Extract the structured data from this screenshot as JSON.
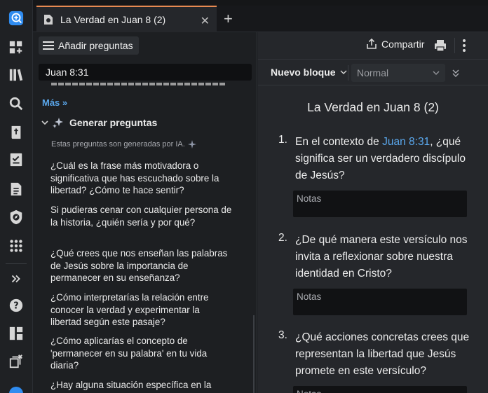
{
  "rail": {
    "icons": [
      "app-logo-icon",
      "dashboard-add-icon",
      "library-icon",
      "search-icon",
      "bible-icon",
      "checklist-icon",
      "document-icon",
      "compass-icon",
      "apps-grid-icon",
      "expand-chevrons-icon",
      "help-icon",
      "layout-icon",
      "close-panels-icon"
    ]
  },
  "tab": {
    "title": "La Verdad en Juan 8 (2)",
    "close": "✕",
    "new": "+"
  },
  "left": {
    "add_questions": "Añadir preguntas",
    "search_value": "Juan 8:31",
    "more": "Más »",
    "generate_label": "Generar preguntas",
    "ai_note": "Estas preguntas son generadas por IA.",
    "questions": [
      "¿Cuál es la frase más motivadora o significativa que has escuchado sobre la libertad? ¿Cómo te hace sentir?",
      "Si pudieras cenar con cualquier persona de la historia, ¿quién sería y por qué?",
      "¿Qué crees que nos enseñan las palabras de Jesús sobre la importancia de permanecer en su enseñanza?",
      "¿Cómo interpretarías la relación entre conocer la verdad y experimentar la libertad según este pasaje?",
      "¿Cómo aplicarías el concepto de 'permanecer en su palabra' en tu vida diaria?",
      "¿Hay alguna situación específica en la"
    ]
  },
  "right": {
    "share": "Compartir",
    "block_type": "Nuevo bloque",
    "style_select": "Normal",
    "doc_title": "La Verdad en Juan 8 (2)",
    "items": [
      {
        "num": "1.",
        "pre": "En el contexto de ",
        "ref": "Juan 8:31",
        "post": ", ¿qué significa ser un verdadero discípulo de Jesús?",
        "notes": "Notas"
      },
      {
        "num": "2.",
        "text": "¿De qué manera este versículo nos invita a reflexionar sobre nuestra identidad en Cristo?",
        "notes": "Notas"
      },
      {
        "num": "3.",
        "text": "¿Qué acciones concretas crees que representan la libertad que Jesús promete en este versículo?",
        "notes": "Notas"
      }
    ]
  },
  "colors": {
    "accent": "#5aa7ec",
    "tab_highlight": "#e88a52",
    "logo_blue": "#2f8cf0"
  }
}
